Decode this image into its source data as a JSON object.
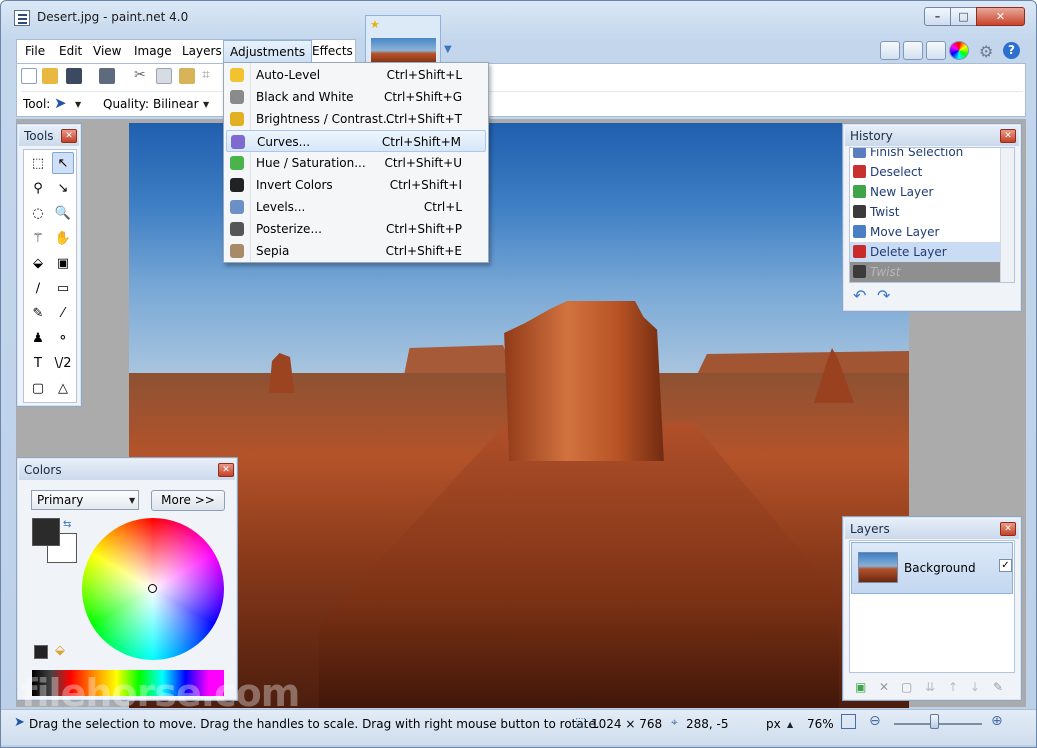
{
  "window": {
    "title": "Desert.jpg - paint.net 4.0",
    "min_label": "–",
    "max_label": "□",
    "close_label": "✕"
  },
  "menubar": {
    "items": [
      "File",
      "Edit",
      "View",
      "Image",
      "Layers",
      "Adjustments",
      "Effects"
    ]
  },
  "toolbar": {
    "tool_label": "Tool:",
    "quality_label": "Quality:",
    "quality_value": "Bilinear"
  },
  "adjustments_menu": {
    "items": [
      {
        "label": "Auto-Level",
        "shortcut": "Ctrl+Shift+L",
        "icon": "auto-level-icon",
        "color": "#f2c230"
      },
      {
        "label": "Black and White",
        "shortcut": "Ctrl+Shift+G",
        "icon": "black-and-white-icon",
        "color": "#8a8a8a"
      },
      {
        "label": "Brightness / Contrast...",
        "shortcut": "Ctrl+Shift+T",
        "icon": "brightness-contrast-icon",
        "color": "#e0b020"
      },
      {
        "label": "Curves...",
        "shortcut": "Ctrl+Shift+M",
        "icon": "curves-icon",
        "color": "#7f6bd0"
      },
      {
        "label": "Hue / Saturation...",
        "shortcut": "Ctrl+Shift+U",
        "icon": "hue-saturation-icon",
        "color": "#4bb34b"
      },
      {
        "label": "Invert Colors",
        "shortcut": "Ctrl+Shift+I",
        "icon": "invert-colors-icon",
        "color": "#222222"
      },
      {
        "label": "Levels...",
        "shortcut": "Ctrl+L",
        "icon": "levels-icon",
        "color": "#6d8fc8"
      },
      {
        "label": "Posterize...",
        "shortcut": "Ctrl+Shift+P",
        "icon": "posterize-icon",
        "color": "#555555"
      },
      {
        "label": "Sepia",
        "shortcut": "Ctrl+Shift+E",
        "icon": "sepia-icon",
        "color": "#a88a68"
      }
    ],
    "highlighted": "Curves..."
  },
  "tools_panel": {
    "title": "Tools",
    "tools": [
      "⬚",
      "↖",
      "⚲",
      "↘",
      "◌",
      "🔍",
      "⚚",
      "✋",
      "⬙",
      "▣",
      "∕",
      "▭",
      "✎",
      "⁄",
      "♟",
      "⚬",
      "T",
      "\\/2",
      "▢",
      "△"
    ]
  },
  "history_panel": {
    "title": "History",
    "items": [
      {
        "label": "Finish Selection",
        "icon": "finish-selection-icon",
        "color": "#5a7fbf"
      },
      {
        "label": "Deselect",
        "icon": "deselect-icon",
        "color": "#c93030"
      },
      {
        "label": "New Layer",
        "icon": "new-layer-icon",
        "color": "#3fa44a"
      },
      {
        "label": "Twist",
        "icon": "twist-icon",
        "color": "#3b3b3b"
      },
      {
        "label": "Move Layer",
        "icon": "move-layer-icon",
        "color": "#4a7fc5"
      },
      {
        "label": "Delete Layer",
        "icon": "delete-layer-icon",
        "color": "#c92b2b"
      },
      {
        "label": "Twist",
        "icon": "twist-icon",
        "color": "#3b3b3b"
      }
    ],
    "selected": "Delete Layer"
  },
  "layers_panel": {
    "title": "Layers",
    "layers": [
      {
        "name": "Background",
        "visible": true
      }
    ]
  },
  "colors_panel": {
    "title": "Colors",
    "mode": "Primary",
    "more_label": "More >>",
    "primary_color": "#2b2b2b",
    "secondary_color": "#ffffff"
  },
  "status": {
    "hint": "Drag the selection to move. Drag the handles to scale. Drag with right mouse button to rotate.",
    "image_size": "1024 × 768",
    "cursor_pos": "288, -5",
    "unit": "px",
    "zoom": "76%"
  },
  "watermark": "filehorse.com"
}
